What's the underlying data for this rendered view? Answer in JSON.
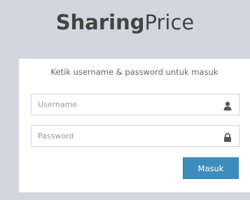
{
  "logo": {
    "bold": "Sharing",
    "light": "Price"
  },
  "login": {
    "message": "Ketik username & password untuk masuk",
    "username_placeholder": "Username",
    "username_value": "",
    "password_placeholder": "Password",
    "password_value": "",
    "submit_label": "Masuk"
  },
  "icons": {
    "username": "user-icon",
    "password": "lock-icon"
  },
  "colors": {
    "background": "#d2d6de",
    "button": "#3c8dbc",
    "text": "#444444"
  }
}
